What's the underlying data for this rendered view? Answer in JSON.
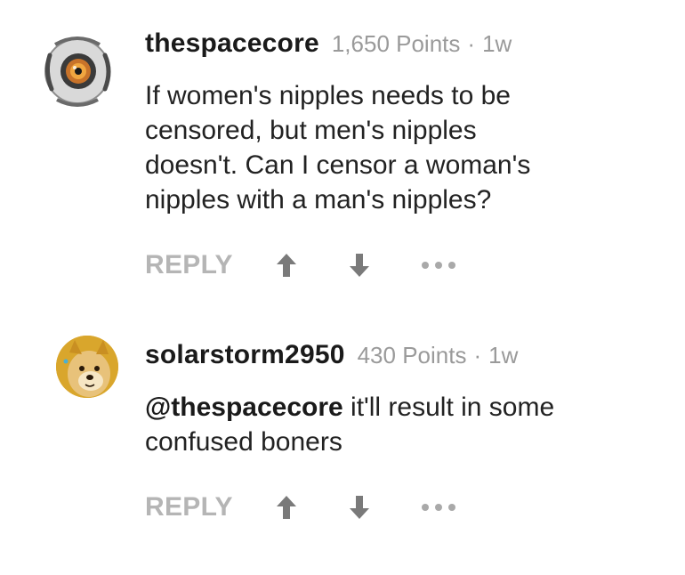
{
  "comments": [
    {
      "username": "thespacecore",
      "points": "1,650 Points",
      "separator": "·",
      "age": "1w",
      "body_lines": [
        "If women's nipples needs to be",
        "censored, but men's nipples",
        "doesn't. Can I censor a woman's",
        "nipples with a man's nipples?"
      ],
      "reply_label": "REPLY",
      "avatar_icon": "space-core-avatar-icon",
      "up_icon": "upvote-arrow-icon",
      "down_icon": "downvote-arrow-icon",
      "more_icon": "more-options-icon"
    },
    {
      "username": "solarstorm2950",
      "points": "430 Points",
      "separator": "·",
      "age": "1w",
      "mention": "@thespacecore",
      "body_first_line_rest": " it'll result in some",
      "body_lines": [
        "confused boners"
      ],
      "reply_label": "REPLY",
      "avatar_icon": "doge-avatar-icon",
      "up_icon": "upvote-arrow-icon",
      "down_icon": "downvote-arrow-icon",
      "more_icon": "more-options-icon"
    }
  ],
  "colors": {
    "username": "#1a1a1a",
    "meta": "#9a9a9a",
    "body": "#222222",
    "action": "#b5b5b5",
    "arrow": "#7a7a7a"
  }
}
